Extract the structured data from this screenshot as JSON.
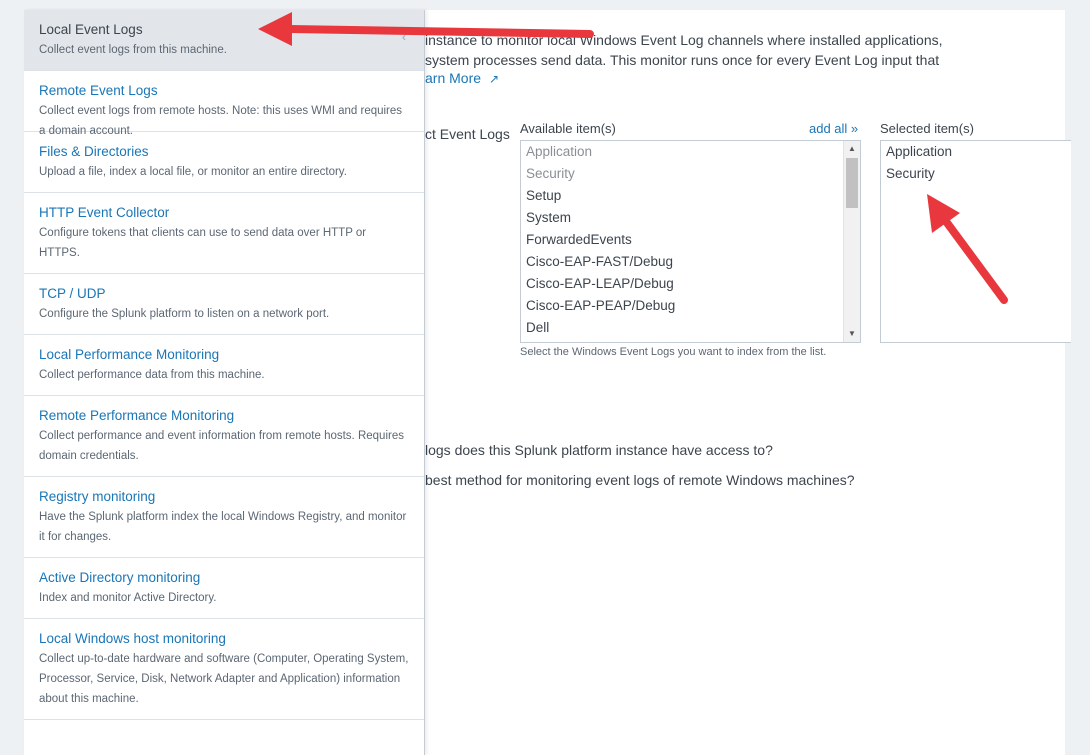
{
  "sidebar": {
    "items": [
      {
        "title": "Local Event Logs",
        "desc": "Collect event logs from this machine."
      },
      {
        "title": "Remote Event Logs",
        "desc": "Collect event logs from remote hosts. Note: this uses WMI and requires a domain account."
      },
      {
        "title": "Files & Directories",
        "desc": "Upload a file, index a local file, or monitor an entire directory."
      },
      {
        "title": "HTTP Event Collector",
        "desc": "Configure tokens that clients can use to send data over HTTP or HTTPS."
      },
      {
        "title": "TCP / UDP",
        "desc": "Configure the Splunk platform to listen on a network port."
      },
      {
        "title": "Local Performance Monitoring",
        "desc": "Collect performance data from this machine."
      },
      {
        "title": "Remote Performance Monitoring",
        "desc": "Collect performance and event information from remote hosts. Requires domain credentials."
      },
      {
        "title": "Registry monitoring",
        "desc": "Have the Splunk platform index the local Windows Registry, and monitor it for changes."
      },
      {
        "title": "Active Directory monitoring",
        "desc": "Index and monitor Active Directory."
      },
      {
        "title": "Local Windows host monitoring",
        "desc": "Collect up-to-date hardware and software (Computer, Operating System, Processor, Service, Disk, Network Adapter and Application) information about this machine."
      }
    ]
  },
  "main": {
    "description": "instance to monitor local Windows Event Log channels where installed applications,\nsystem processes send data. This monitor runs once for every Event Log input that",
    "learn_more": "arn More",
    "field_label": "ct Event Logs",
    "available_label": "Available item(s)",
    "add_all": "add all »",
    "selected_label": "Selected item(s)",
    "available_items": [
      {
        "label": "Application",
        "state": "selected"
      },
      {
        "label": "Security",
        "state": "selected"
      },
      {
        "label": "Setup",
        "state": "available"
      },
      {
        "label": "System",
        "state": "available"
      },
      {
        "label": "ForwardedEvents",
        "state": "available"
      },
      {
        "label": "Cisco-EAP-FAST/Debug",
        "state": "available"
      },
      {
        "label": "Cisco-EAP-LEAP/Debug",
        "state": "available"
      },
      {
        "label": "Cisco-EAP-PEAP/Debug",
        "state": "available"
      },
      {
        "label": "Dell",
        "state": "available"
      }
    ],
    "selected_items": [
      "Application",
      "Security"
    ],
    "hint": "Select the Windows Event Logs you want to index from the list.",
    "faq": [
      "logs does this Splunk platform instance have access to?",
      "best method for monitoring event logs of remote Windows machines?"
    ]
  },
  "icons": {
    "external_link": "external-link-icon",
    "chevron": "chevron-left-icon",
    "scroll_up": "scroll-up-icon",
    "scroll_down": "scroll-down-icon"
  },
  "colors": {
    "link": "#1a76b6",
    "annotation_arrow": "#e8383d",
    "active_item_bg": "#e2e6ea"
  }
}
